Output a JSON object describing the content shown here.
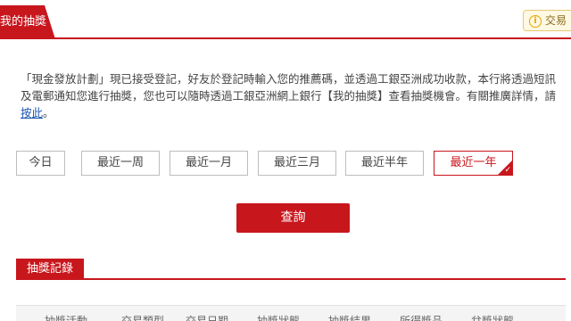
{
  "tabs": {
    "active_label": "我的抽獎"
  },
  "notice": {
    "label": "交易",
    "icon": "info-icon"
  },
  "description": {
    "text_before": "「現金發放計劃」現已接受登記，好友於登記時輸入您的推薦碼，並透過工銀亞洲成功收款，本行將透過短訊及電郵通知您進行抽獎，您也可以隨時透過工銀亞洲網上銀行【我的抽獎】查看抽獎機會。有關推廣詳情，請",
    "link_text": "按此",
    "text_after": "。"
  },
  "filters": [
    {
      "label": "今日",
      "selected": false
    },
    {
      "label": "最近一周",
      "selected": false
    },
    {
      "label": "最近一月",
      "selected": false
    },
    {
      "label": "最近三月",
      "selected": false
    },
    {
      "label": "最近半年",
      "selected": false
    },
    {
      "label": "最近一年",
      "selected": true
    }
  ],
  "query_button": {
    "label": "查詢"
  },
  "records": {
    "title": "抽獎記錄",
    "columns": [
      "抽獎活動",
      "交易類型",
      "交易日期",
      "抽獎狀態",
      "抽獎結果",
      "所得獎品",
      "兌獎狀態"
    ]
  },
  "colors": {
    "accent": "#c8161d",
    "link": "#1a56b0",
    "notice_bg": "#fff8e2"
  }
}
